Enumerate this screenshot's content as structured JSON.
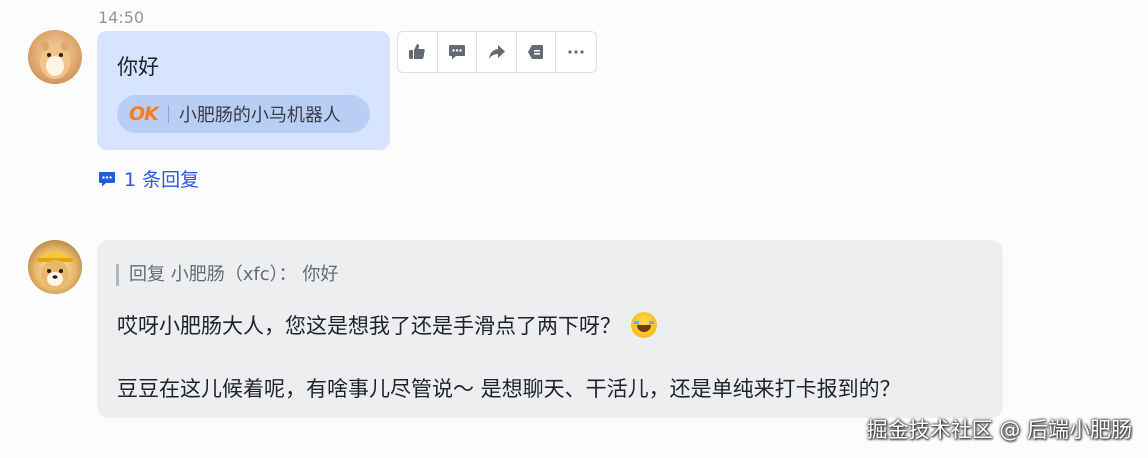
{
  "message1": {
    "time": "14:50",
    "text": "你好",
    "quote_logo": "OK",
    "quote_label": "小肥肠的小马机器人",
    "actions": [
      "thumbs-up-icon",
      "comment-icon",
      "forward-icon",
      "pin-icon",
      "more-icon"
    ]
  },
  "thread": {
    "reply_count_label": "1 条回复"
  },
  "message2": {
    "reply_quote": "回复 小肥肠（xfc）： 你好",
    "line1": "哎呀小肥肠大人，您这是想我了还是手滑点了两下呀？",
    "line2": "豆豆在这儿候着呢，有啥事儿尽管说～ 是想聊天、干活儿，还是单纯来打卡报到的？"
  },
  "watermark": "掘金技术社区 @ 后端小肥肠",
  "colors": {
    "bubble_self": "#d6e4ff",
    "bubble_bot": "#eceef0",
    "link_blue": "#245bdb"
  }
}
